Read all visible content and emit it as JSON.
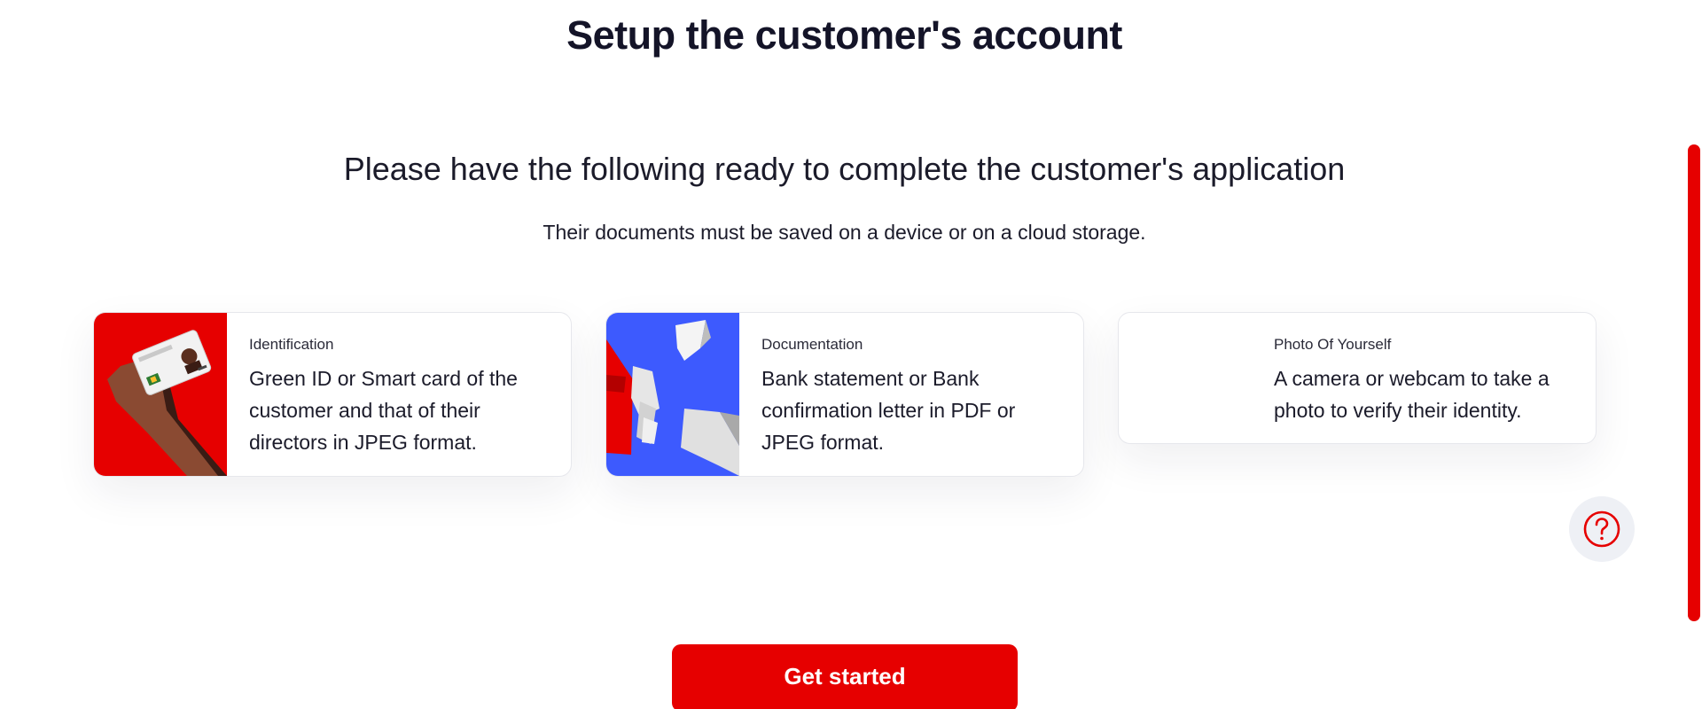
{
  "page": {
    "title": "Setup the customer's account",
    "heading": "Please have the following ready to complete the customer's application",
    "subheading": "Their documents must be saved on a device or on a cloud storage."
  },
  "requirements": [
    {
      "label": "Identification",
      "description": "Green ID or Smart card of the customer and that of their directors in JPEG format.",
      "icon": "id-card-hand-illustration"
    },
    {
      "label": "Documentation",
      "description": "Bank statement or Bank confirmation letter in PDF or JPEG format.",
      "icon": "documents-illustration"
    },
    {
      "label": "Photo Of Yourself",
      "description": "A camera or webcam to take a photo to verify their identity.",
      "icon": "photo-illustration"
    }
  ],
  "help": {
    "icon": "question-circle-icon"
  },
  "cta": {
    "label": "Get started"
  },
  "colors": {
    "brand": "#e60000",
    "docs_background": "#3d5afe",
    "text": "#1b1b2a"
  }
}
